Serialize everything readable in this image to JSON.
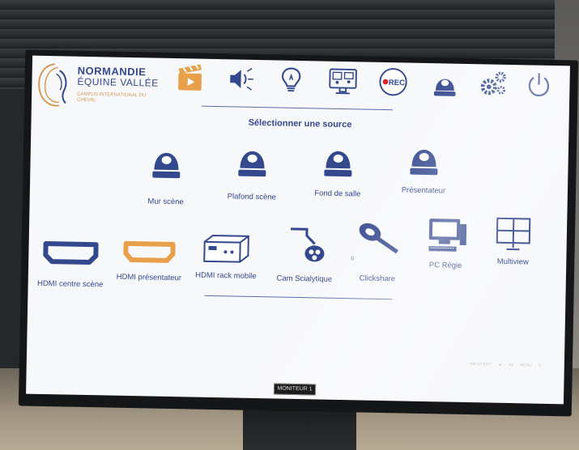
{
  "brand": {
    "line1": "NORMANDIE",
    "line2": "ÉQUINE VALLÉE",
    "line3": "CAMPUS INTERNATIONAL DU CHEVAL"
  },
  "toolbar": [
    {
      "name": "video-icon",
      "color": "#e8a04b"
    },
    {
      "name": "audio-icon",
      "color": "#34488e"
    },
    {
      "name": "light-icon",
      "color": "#34488e"
    },
    {
      "name": "visio-icon",
      "color": "#34488e"
    },
    {
      "name": "rec-icon",
      "label": "REC",
      "color": "#34488e"
    },
    {
      "name": "camera-icon",
      "color": "#34488e"
    },
    {
      "name": "settings-icon",
      "color": "#34488e"
    },
    {
      "name": "power-icon",
      "color": "#34488e"
    }
  ],
  "prompt": "Sélectionner une source",
  "cameras": [
    {
      "label": "Mur scène"
    },
    {
      "label": "Plafond scène"
    },
    {
      "label": "Fond de salle"
    },
    {
      "label": "Présentateur"
    }
  ],
  "sources": [
    {
      "label": "HDMI centre scène"
    },
    {
      "label": "HDMI présentateur"
    },
    {
      "label": "HDMI rack mobile"
    },
    {
      "label": "Cam Scialytique"
    },
    {
      "label": "Clickshare",
      "sub": "b"
    },
    {
      "label": "PC Régie"
    },
    {
      "label": "Multiview"
    }
  ],
  "monitor": {
    "label": "MONITEUR 1",
    "buttons": [
      "INPUT EXIT",
      "◂)",
      "◂ ▸",
      "MENU",
      "⏻"
    ]
  },
  "colors": {
    "primary": "#34488e",
    "accent": "#e8a04b",
    "rec": "#d8232a"
  }
}
